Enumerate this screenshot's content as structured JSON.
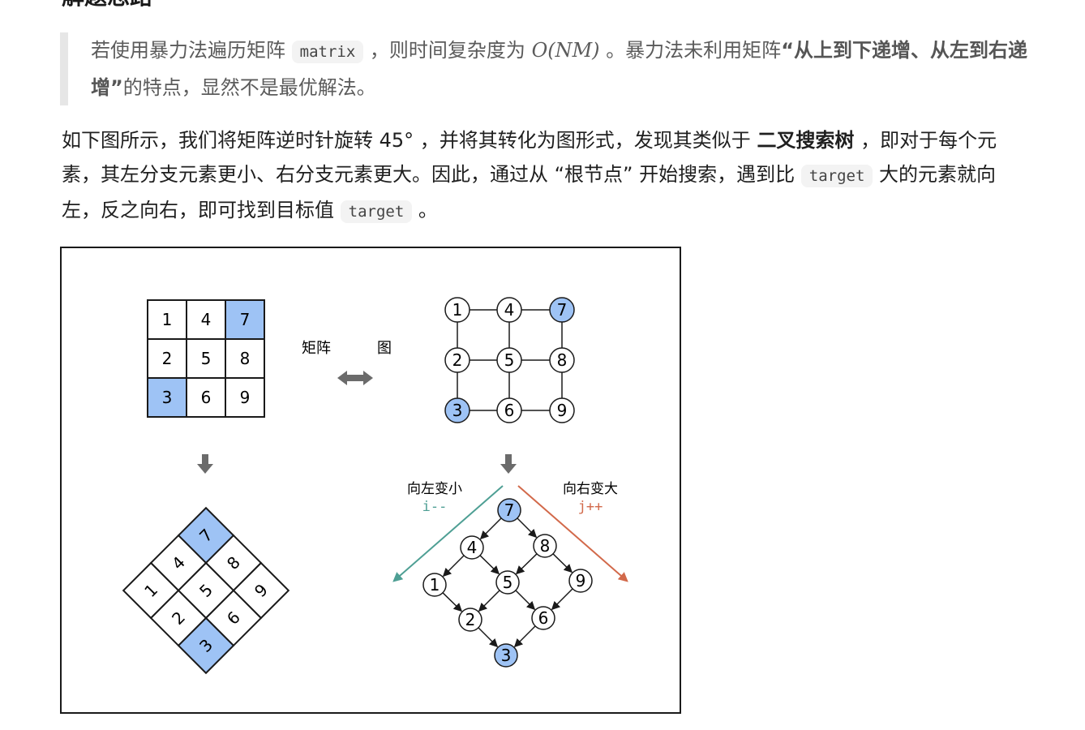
{
  "heading": "解题思路",
  "quote": {
    "p1": "若使用暴力法遍历矩阵",
    "code_matrix": "matrix",
    "p2": "，则时间复杂度为",
    "complexity": "O(NM)",
    "p3": "。暴力法未利用矩阵",
    "bold": "“从上到下递增、从左到右递增”",
    "p4": "的特点，显然不是最优解法。"
  },
  "para": {
    "p1": "如下图所示，我们将矩阵逆时针旋转 45° ，并将其转化为图形式，发现其类似于",
    "bold": "二叉搜索树",
    "p2": "，即对于每个元素，其左分支元素更小、右分支元素更大。因此，通过从 “根节点” 开始搜索，遇到比",
    "code_target_1": "target",
    "p3": "大的元素就向左，反之向右，即可找到目标值",
    "code_target_2": "target",
    "p4": "。"
  },
  "figure": {
    "label_matrix": "矩阵",
    "label_graph": "图",
    "matrix_cells": [
      "1",
      "4",
      "7",
      "2",
      "5",
      "8",
      "3",
      "6",
      "9"
    ],
    "graph_nodes": [
      "1",
      "4",
      "7",
      "2",
      "5",
      "8",
      "3",
      "6",
      "9"
    ],
    "tree_nodes": [
      "7",
      "4",
      "8",
      "1",
      "5",
      "9",
      "2",
      "6",
      "3"
    ],
    "rotated_cells": [
      "7",
      "4",
      "8",
      "1",
      "5",
      "9",
      "2",
      "6",
      "3"
    ],
    "label_left": "向左变小",
    "label_left_code": "i--",
    "label_right": "向右变大",
    "label_right_code": "j++",
    "colors": {
      "highlight": "#9ec3f5",
      "left_arrow": "#4e9f94",
      "right_arrow": "#d2694a",
      "arrow_gray": "#6b6b6b"
    }
  }
}
